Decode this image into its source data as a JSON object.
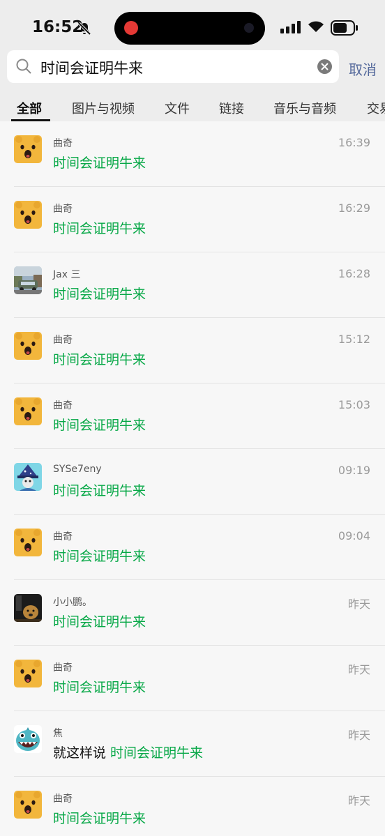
{
  "status": {
    "time": "16:52"
  },
  "search": {
    "query": "时间会证明牛来",
    "cancel_label": "取消"
  },
  "tabs": [
    {
      "label": "全部",
      "active": true
    },
    {
      "label": "图片与视频"
    },
    {
      "label": "文件"
    },
    {
      "label": "链接"
    },
    {
      "label": "音乐与音频"
    },
    {
      "label": "交易"
    }
  ],
  "results": [
    {
      "sender": "曲奇",
      "time": "16:39",
      "prefix": "",
      "match": "时间会证明牛来",
      "avatar": "bear-avatar"
    },
    {
      "sender": "曲奇",
      "time": "16:29",
      "prefix": "",
      "match": "时间会证明牛来",
      "avatar": "bear-avatar"
    },
    {
      "sender": "Jax 三",
      "time": "16:28",
      "prefix": "",
      "match": "时间会证明牛来",
      "avatar": "car-photo-avatar"
    },
    {
      "sender": "曲奇",
      "time": "15:12",
      "prefix": "",
      "match": "时间会证明牛来",
      "avatar": "bear-avatar"
    },
    {
      "sender": "曲奇",
      "time": "15:03",
      "prefix": "",
      "match": "时间会证明牛来",
      "avatar": "bear-avatar"
    },
    {
      "sender": "SYSe7eny",
      "time": "09:19",
      "prefix": "",
      "match": "时间会证明牛来",
      "avatar": "wizard-avatar"
    },
    {
      "sender": "曲奇",
      "time": "09:04",
      "prefix": "",
      "match": "时间会证明牛来",
      "avatar": "bear-avatar"
    },
    {
      "sender": "小小鹏。",
      "time": "昨天",
      "prefix": "",
      "match": "时间会证明牛来",
      "avatar": "dog-photo-avatar"
    },
    {
      "sender": "曲奇",
      "time": "昨天",
      "prefix": "",
      "match": "时间会证明牛来",
      "avatar": "bear-avatar"
    },
    {
      "sender": "焦",
      "time": "昨天",
      "prefix": "就这样说 ",
      "match": "时间会证明牛来",
      "avatar": "shark-avatar"
    },
    {
      "sender": "曲奇",
      "time": "昨天",
      "prefix": "",
      "match": "时间会证明牛来",
      "avatar": "bear-avatar"
    }
  ],
  "colors": {
    "highlight": "#07a847",
    "link": "#52679a",
    "bear": "#f2b63c"
  }
}
